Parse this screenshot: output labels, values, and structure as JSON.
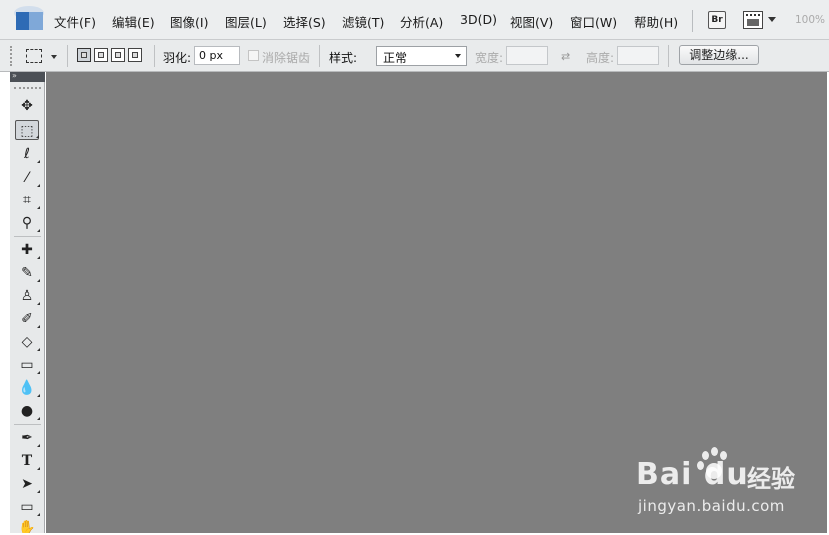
{
  "app": {
    "logo_icon": "photoshop-logo-icon"
  },
  "menubar": {
    "items": [
      {
        "label": "文件(F)"
      },
      {
        "label": "编辑(E)"
      },
      {
        "label": "图像(I)"
      },
      {
        "label": "图层(L)"
      },
      {
        "label": "选择(S)"
      },
      {
        "label": "滤镜(T)"
      },
      {
        "label": "分析(A)"
      },
      {
        "label": "3D(D)"
      },
      {
        "label": "视图(V)"
      },
      {
        "label": "窗口(W)"
      },
      {
        "label": "帮助(H)"
      }
    ],
    "bridge_label": "Br",
    "zoom": "100%"
  },
  "options": {
    "feather_label": "羽化:",
    "feather_value": "0 px",
    "antialias_label": "消除锯齿",
    "style_label": "样式:",
    "style_value": "正常",
    "width_label": "宽度:",
    "height_label": "高度:",
    "swap_icon": "⇄",
    "refine_label": "调整边缘..."
  },
  "toolbox": {
    "collapse_label": "»",
    "tools": [
      {
        "icon": "move-icon",
        "glyph": "✥"
      },
      {
        "icon": "rect-marquee-icon",
        "glyph": "⬚"
      },
      {
        "icon": "lasso-icon",
        "glyph": "ℓ"
      },
      {
        "icon": "magic-wand-icon",
        "glyph": "⁄"
      },
      {
        "icon": "crop-icon",
        "glyph": "⌗"
      },
      {
        "icon": "eyedropper-icon",
        "glyph": "⚲"
      },
      {
        "icon": "healing-brush-icon",
        "glyph": "✚"
      },
      {
        "icon": "brush-icon",
        "glyph": "✎"
      },
      {
        "icon": "clone-stamp-icon",
        "glyph": "♙"
      },
      {
        "icon": "history-brush-icon",
        "glyph": "✐"
      },
      {
        "icon": "eraser-icon",
        "glyph": "◇"
      },
      {
        "icon": "gradient-icon",
        "glyph": "▭"
      },
      {
        "icon": "blur-icon",
        "glyph": "💧"
      },
      {
        "icon": "dodge-icon",
        "glyph": "●"
      },
      {
        "icon": "pen-icon",
        "glyph": "✒"
      },
      {
        "icon": "type-icon",
        "glyph": "T"
      },
      {
        "icon": "path-selection-icon",
        "glyph": "➤"
      },
      {
        "icon": "shape-icon",
        "glyph": "▭"
      },
      {
        "icon": "hand-icon",
        "glyph": "✋"
      }
    ]
  },
  "watermark": {
    "brand": "Bai  du",
    "cn": "经验",
    "url": "jingyan.baidu.com"
  },
  "colors": {
    "canvas_bg": "#7f7f7f",
    "chrome_bg": "#eceeef",
    "accent": "#2e6bb5"
  }
}
